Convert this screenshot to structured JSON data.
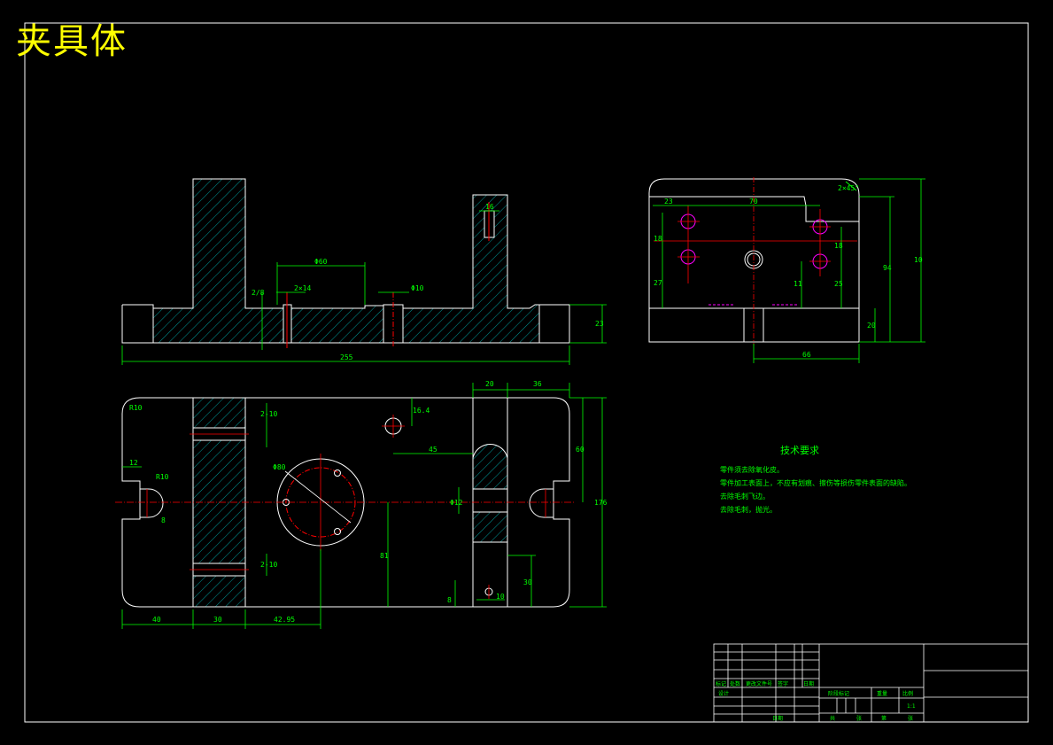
{
  "drawing": {
    "title": "夹具体",
    "colors": {
      "background": "#000000",
      "outline": "#ffffff",
      "dimension": "#00ff00",
      "hatch": "#00c0c0",
      "centerline": "#ff0000",
      "hidden": "#ff00ff",
      "title": "#ffff00"
    }
  },
  "front_view": {
    "dims": {
      "overall_length": "255",
      "top_width": "Φ60",
      "hole_small": "Φ10",
      "slot_width": "16",
      "slot_depth": "2×14",
      "step_height": "2/8",
      "base_height": "23"
    }
  },
  "side_view": {
    "dims": {
      "top_span": "70",
      "left_offset": "23",
      "chamfer": "2×45°",
      "height_1": "94",
      "height_2": "10",
      "h_left_1": "18",
      "h_left_2": "27",
      "h_mid": "18",
      "h_right": "25",
      "h_mid_2": "11",
      "base_h": "20",
      "bottom_span": "66"
    }
  },
  "top_view": {
    "dims": {
      "corner": "R10",
      "left_slot": "12",
      "slot_radius": "R10",
      "slot_angle": "8",
      "bolt_circle": "Φ80",
      "keyway_1": "2-10",
      "keyway_2": "2-10",
      "small_hole": "16.4",
      "offset_45": "45",
      "top_20": "20",
      "top_36": "36",
      "right_60": "60",
      "right_176": "176",
      "center_12": "Φ12",
      "v_81": "81",
      "v_30": "30",
      "v_8": "8",
      "h_10": "10",
      "bottom_40": "40",
      "bottom_30": "30",
      "bottom_42": "42.95"
    }
  },
  "tech_requirements": {
    "title": "技术要求",
    "lines": [
      "零件须去除氧化皮。",
      "零件加工表面上，不应有划痕、擦伤等损伤零件表面的缺陷。",
      "去除毛刺飞边。",
      "去除毛刺，抛光。"
    ]
  },
  "title_block": {
    "labels": {
      "mark": "标记",
      "count": "处数",
      "division": "更改文件号",
      "sign": "签字",
      "date": "日期",
      "design": "设计",
      "stage_mark": "阶段标记",
      "weight": "重量",
      "scale": "比例",
      "scale_value": "1:1",
      "sheet": "共",
      "sheet_of": "张",
      "page": "第",
      "approve": "日期"
    }
  }
}
